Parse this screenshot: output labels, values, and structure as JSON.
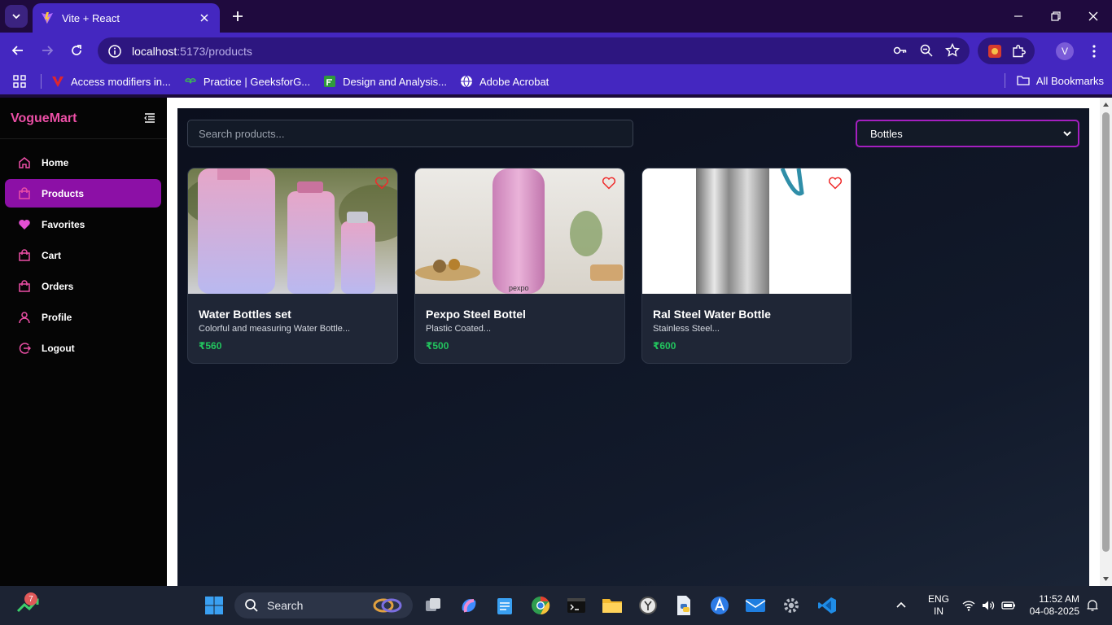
{
  "browser": {
    "tab_title": "Vite + React",
    "url_host": "localhost",
    "url_path": ":5173/products",
    "profile_initial": "V",
    "bookmarks": [
      {
        "label": "Access modifiers in..."
      },
      {
        "label": "Practice | GeeksforG..."
      },
      {
        "label": "Design and Analysis..."
      },
      {
        "label": "Adobe Acrobat"
      }
    ],
    "all_bookmarks": "All Bookmarks"
  },
  "app": {
    "brand": "VogueMart",
    "nav": [
      {
        "label": "Home",
        "icon": "home-icon"
      },
      {
        "label": "Products",
        "icon": "shopping-bag-icon"
      },
      {
        "label": "Favorites",
        "icon": "heart-icon"
      },
      {
        "label": "Cart",
        "icon": "shopping-bag-icon"
      },
      {
        "label": "Orders",
        "icon": "shopping-bag-icon"
      },
      {
        "label": "Profile",
        "icon": "user-icon"
      },
      {
        "label": "Logout",
        "icon": "logout-icon"
      }
    ],
    "active_nav": "Products",
    "accent_color": "#8c10a6",
    "brand_color": "#ec4fa6",
    "price_color": "#22c55e",
    "search_placeholder": "Search products...",
    "category_selected": "Bottles",
    "products": [
      {
        "title": "Water Bottles set",
        "desc": "Colorful and measuring Water Bottle...",
        "price": "₹560"
      },
      {
        "title": "Pexpo Steel Bottel",
        "desc": "Plastic Coated...",
        "price": "₹500"
      },
      {
        "title": "Ral Steel Water Bottle",
        "desc": "Stainless Steel...",
        "price": "₹600"
      }
    ]
  },
  "taskbar": {
    "widget_badge": "7",
    "search_label": "Search",
    "lang_top": "ENG",
    "lang_bottom": "IN",
    "time": "11:52 AM",
    "date": "04-08-2025"
  }
}
